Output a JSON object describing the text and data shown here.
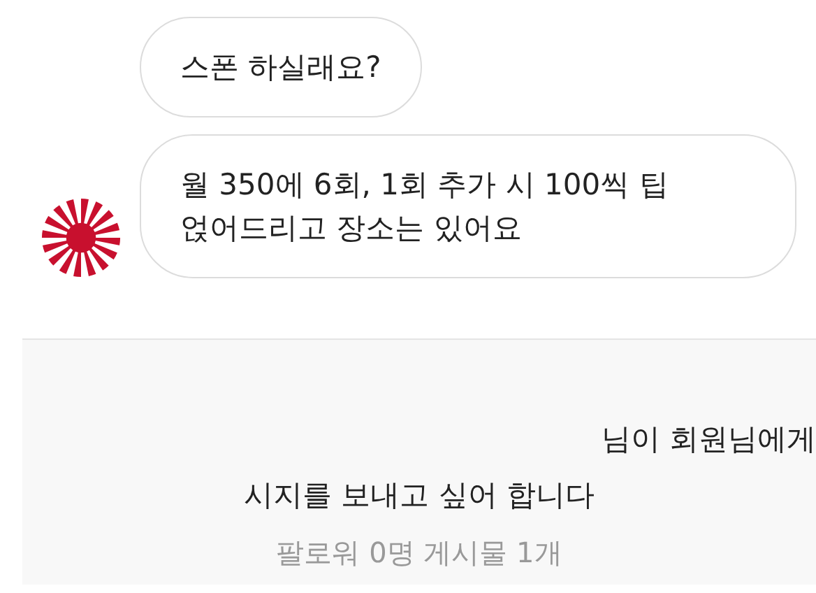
{
  "messages": [
    {
      "text": "스폰 하실래요?",
      "show_avatar": false
    },
    {
      "text": "월 350에 6회, 1회 추가 시 100씩 팁 얹어드리고 장소는 있어요",
      "show_avatar": true
    }
  ],
  "request": {
    "line_1": "님이 회원님에게",
    "line_2": "시지를 보내고 싶어 합니다",
    "stats": "팔로워 0명 게시물 1개"
  }
}
